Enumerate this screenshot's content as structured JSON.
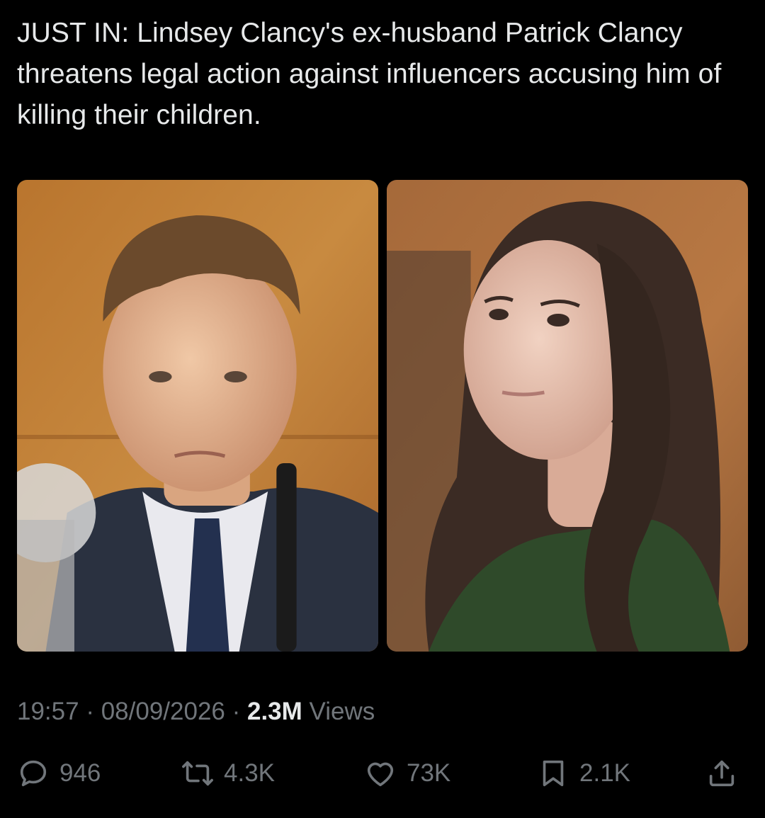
{
  "tweet": {
    "text": "JUST IN: Lindsey Clancy's ex-husband Patrick Clancy threatens legal action against influencers accusing him of killing their children."
  },
  "media": [
    {
      "icon": "photo-man-in-suit"
    },
    {
      "icon": "photo-woman-green-blouse"
    }
  ],
  "meta": {
    "time": "19:57",
    "separator": " · ",
    "date": "08/09/2026",
    "views_count": "2.3M",
    "views_label": " Views"
  },
  "actions": {
    "reply": {
      "icon": "reply-icon",
      "count": "946"
    },
    "retweet": {
      "icon": "retweet-icon",
      "count": "4.3K"
    },
    "like": {
      "icon": "heart-icon",
      "count": "73K"
    },
    "bookmark": {
      "icon": "bookmark-icon",
      "count": "2.1K"
    },
    "share": {
      "icon": "share-icon"
    }
  },
  "colors": {
    "background": "#000000",
    "text": "#e7e9ea",
    "secondary": "#71767b"
  }
}
